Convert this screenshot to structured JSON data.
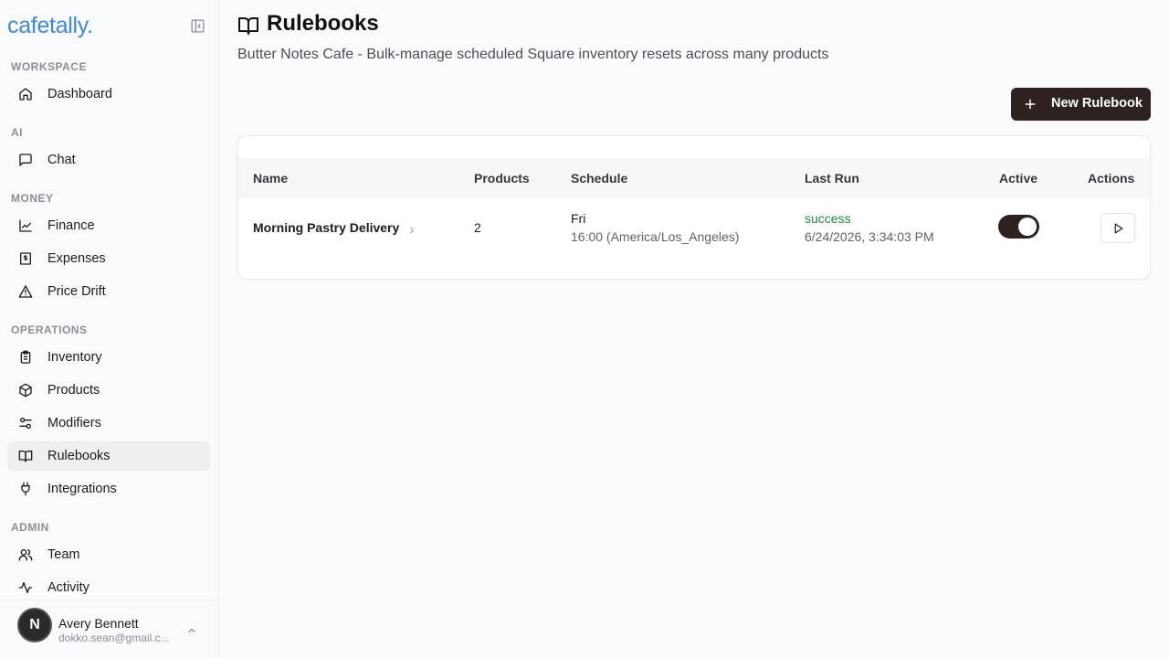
{
  "app": {
    "logo": "cafetally."
  },
  "sidebar": {
    "sections": {
      "workspace": "WORKSPACE",
      "ai": "AI",
      "money": "MONEY",
      "operations": "OPERATIONS",
      "admin": "ADMIN"
    },
    "items": {
      "dashboard": "Dashboard",
      "chat": "Chat",
      "finance": "Finance",
      "expenses": "Expenses",
      "price_drift": "Price Drift",
      "inventory": "Inventory",
      "products": "Products",
      "modifiers": "Modifiers",
      "rulebooks": "Rulebooks",
      "integrations": "Integrations",
      "team": "Team",
      "activity": "Activity"
    },
    "active_item": "rulebooks",
    "user": {
      "initial": "N",
      "name": "Avery Bennett",
      "email": "dokko.sean@gmail.c..."
    }
  },
  "page": {
    "title": "Rulebooks",
    "subtitle": "Butter Notes Cafe - Bulk-manage scheduled Square inventory resets across many products",
    "new_button": "New Rulebook"
  },
  "table": {
    "headers": {
      "name": "Name",
      "products": "Products",
      "schedule": "Schedule",
      "last_run": "Last Run",
      "active": "Active",
      "actions": "Actions"
    },
    "rows": [
      {
        "name": "Morning Pastry Delivery",
        "products": "2",
        "schedule_day": "Fri",
        "schedule_time": "16:00 (America/Los_Angeles)",
        "last_run_status": "success",
        "last_run_time": "6/24/2026, 3:34:03 PM",
        "active": true
      }
    ]
  },
  "colors": {
    "accent": "#3f86e8",
    "primary_dark": "#2e2220",
    "success": "#1c8a3c"
  }
}
